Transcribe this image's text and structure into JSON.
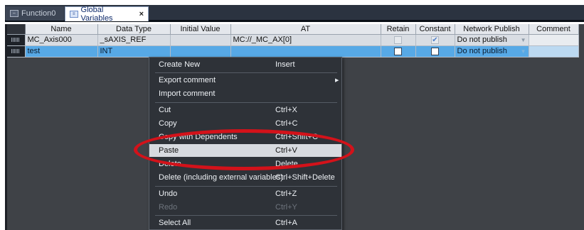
{
  "tabs": [
    {
      "label": "Function0",
      "icon": "function-icon",
      "active": false
    },
    {
      "label": "Global Variables",
      "icon": "variables-icon",
      "active": true,
      "close": "×"
    }
  ],
  "columns": [
    "Name",
    "Data Type",
    "Initial Value",
    "AT",
    "Retain",
    "Constant",
    "Network Publish",
    "Comment"
  ],
  "rows": [
    {
      "name": "MC_Axis000",
      "data_type": "_sAXIS_REF",
      "initial_value": "",
      "at": "MC://_MC_AX[0]",
      "retain": false,
      "constant": true,
      "constant_mark": "✔",
      "network_publish": "Do not publish",
      "comment": ""
    },
    {
      "name": "test",
      "data_type": "INT",
      "initial_value": "",
      "at": "",
      "retain": false,
      "constant": false,
      "network_publish": "Do not publish",
      "comment": ""
    }
  ],
  "dropdown_arrow": "▼",
  "context_menu": {
    "items": [
      {
        "label": "Create New",
        "shortcut": "Insert",
        "enabled": true
      },
      {
        "label": "Export comment",
        "shortcut": "",
        "submenu": true,
        "submenu_arrow": "▶",
        "enabled": true
      },
      {
        "label": "Import comment",
        "shortcut": "",
        "enabled": true
      },
      {
        "label": "Cut",
        "shortcut": "Ctrl+X",
        "enabled": true
      },
      {
        "label": "Copy",
        "shortcut": "Ctrl+C",
        "enabled": true
      },
      {
        "label": "Copy with Dependents",
        "shortcut": "Ctrl+Shift+C",
        "enabled": true
      },
      {
        "label": "Paste",
        "shortcut": "Ctrl+V",
        "enabled": true,
        "highlighted": true
      },
      {
        "label": "Delete",
        "shortcut": "Delete",
        "enabled": true
      },
      {
        "label": "Delete (including external variables)",
        "shortcut": "Ctrl+Shift+Delete",
        "enabled": true
      },
      {
        "label": "Undo",
        "shortcut": "Ctrl+Z",
        "enabled": true
      },
      {
        "label": "Redo",
        "shortcut": "Ctrl+Y",
        "enabled": false
      },
      {
        "label": "Select All",
        "shortcut": "Ctrl+A",
        "enabled": true
      }
    ]
  },
  "colors": {
    "tab_bar": "#2b3340",
    "grid_background": "#3f4247",
    "selected_row": "#57a9e6",
    "menu_background": "#2e3238",
    "highlight_ellipse": "#d3121a"
  }
}
